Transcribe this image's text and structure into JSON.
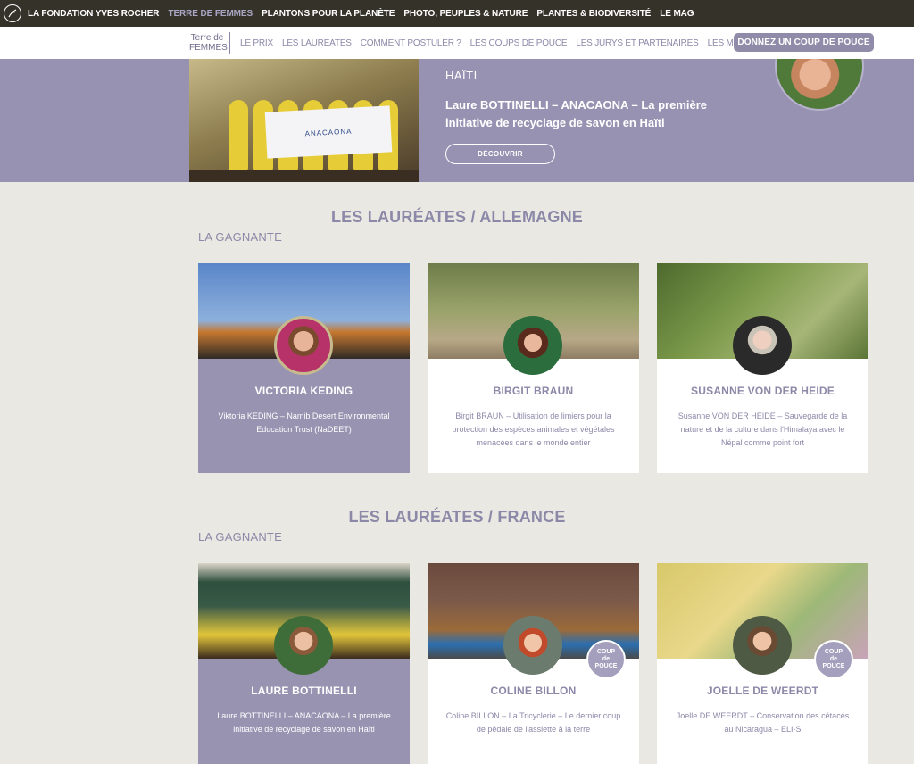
{
  "topnav": {
    "items": [
      {
        "label": "LA FONDATION YVES ROCHER"
      },
      {
        "label": "TERRE DE FEMMES"
      },
      {
        "label": "PLANTONS POUR LA PLANÈTE"
      },
      {
        "label": "PHOTO, PEUPLES & NATURE"
      },
      {
        "label": "PLANTES & BIODIVERSITÉ"
      },
      {
        "label": "LE MAG"
      }
    ],
    "active_index": 1,
    "colors": {
      "background": "#35322a",
      "active": "#a9a6c4"
    }
  },
  "subnav": {
    "brand_line1": "Terre de",
    "brand_line2": "FEMMES",
    "items": [
      {
        "label": "LE PRIX"
      },
      {
        "label": "LES LAUREATES"
      },
      {
        "label": "COMMENT POSTULER ?"
      },
      {
        "label": "LES COUPS DE POUCE"
      },
      {
        "label": "LES JURYS ET PARTENAIRES"
      },
      {
        "label": "LES MENTIONS SPÉCIALES"
      }
    ],
    "cta_label": "DONNEZ UN COUP DE POUCE"
  },
  "hero": {
    "country": "HAÏTI",
    "title": "Laure BOTTINELLI – ANACAONA – La première initiative de recyclage de savon en Haïti",
    "button_label": "DÉCOUVRIR",
    "banner_text": "ANACAONA"
  },
  "sections": [
    {
      "title": "LES LAURÉATES / ALLEMAGNE",
      "subtitle": "LA GAGNANTE",
      "cards": [
        {
          "name": "VICTORIA KEDING",
          "desc": "Viktoria KEDING – Namib Desert Environmental Education Trust (NaDEET)",
          "featured": true
        },
        {
          "name": "BIRGIT BRAUN",
          "desc": "Birgit BRAUN – Utilisation de limiers pour la protection des espèces animales et végétales menacées dans le monde entier",
          "featured": false
        },
        {
          "name": "SUSANNE VON DER HEIDE",
          "desc": "Susanne VON DER HEIDE – Sauvegarde de la nature et de la culture dans l'Himalaya avec le Népal comme point fort",
          "featured": false
        }
      ]
    },
    {
      "title": "LES LAURÉATES / FRANCE",
      "subtitle": "LA GAGNANTE",
      "cards": [
        {
          "name": "LAURE BOTTINELLI",
          "desc": "Laure BOTTINELLI – ANACAONA – La première initiative de recyclage de savon en Haïti",
          "featured": true
        },
        {
          "name": "COLINE BILLON",
          "desc": "Coline BILLON – La Tricyclerie – Le dernier coup de pédale de l'assiette à la terre",
          "featured": false,
          "badge": "coup-de-pouce"
        },
        {
          "name": "JOELLE DE WEERDT",
          "desc": "Joelle DE WEERDT – Conservation des cétacés au Nicaragua – ELI-S",
          "featured": false,
          "badge": "coup-de-pouce"
        }
      ]
    }
  ],
  "badge": {
    "line1": "COUP",
    "line2": "de",
    "line3": "POUCE"
  },
  "colors": {
    "accent": "#8c88a8",
    "hero_bg": "#9892b2",
    "page_bg": "#e9e8e2",
    "featured_card": "#9893b1"
  }
}
